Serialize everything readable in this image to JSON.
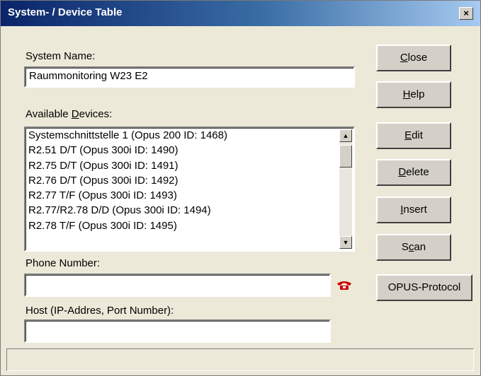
{
  "window": {
    "title": "System- / Device Table",
    "close_glyph": "×"
  },
  "system_name": {
    "label": "System Name:",
    "value": "Raummonitoring W23 E2"
  },
  "available_devices": {
    "label_pre": "Available ",
    "label_u": "D",
    "label_post": "evices:",
    "items": [
      "Systemschnittstelle 1 (Opus 200 ID: 1468)",
      "R2.51 D/T (Opus 300i ID: 1490)",
      "R2.75 D/T (Opus 300i ID: 1491)",
      "R2.76 D/T (Opus 300i ID: 1492)",
      "R2.77 T/F (Opus 300i ID: 1493)",
      "R2.77/R2.78 D/D (Opus 300i ID: 1494)",
      "R2.78 T/F (Opus 300i ID: 1495)"
    ]
  },
  "phone": {
    "label": "Phone Number:",
    "value": "",
    "icon": "telephone-icon",
    "icon_color": "#cc0000"
  },
  "host": {
    "label": "Host (IP-Addres, Port Number):",
    "value": ""
  },
  "buttons": {
    "close": {
      "u": "C",
      "rest": "lose"
    },
    "help": {
      "u": "H",
      "rest": "elp"
    },
    "edit": {
      "u": "E",
      "rest": "dit"
    },
    "delete": {
      "u": "D",
      "rest": "elete"
    },
    "insert": {
      "u": "I",
      "rest": "nsert"
    },
    "scan": {
      "pre": "S",
      "u": "c",
      "rest": "an"
    },
    "opus_protocol": "OPUS-Protocol"
  },
  "status_bar": {
    "text": ""
  }
}
